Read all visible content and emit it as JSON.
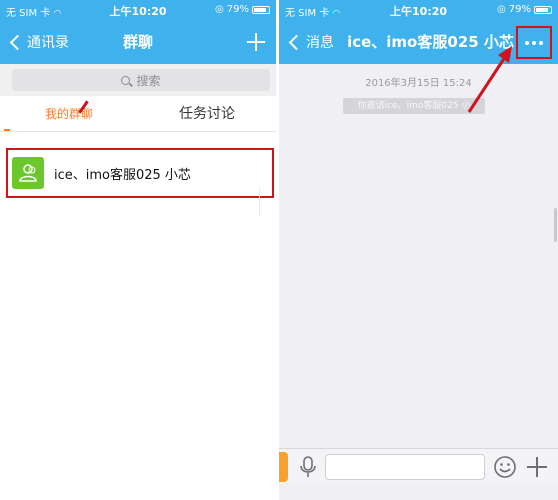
{
  "left": {
    "status": {
      "carrier": "无 SIM 卡",
      "time": "上午10:20",
      "battery": "79%"
    },
    "nav": {
      "back_label": "通讯录",
      "title": "群聊"
    },
    "search": {
      "placeholder": "搜索"
    },
    "tabs": [
      {
        "label": "我的群聊"
      },
      {
        "label": "任务讨论"
      }
    ],
    "groups": [
      {
        "name": "ice、imo客服025 小芯"
      }
    ]
  },
  "right": {
    "status": {
      "carrier": "无 SIM 卡",
      "time": "上午10:20",
      "battery": "79%"
    },
    "nav": {
      "back_label": "消息",
      "title": "ice、imo客服025 小芯"
    },
    "chat": {
      "date": "2016年3月15日 15:24",
      "notice": "你邀请ice、imo客服025 小"
    },
    "input": {
      "value": ""
    }
  },
  "colors": {
    "header_blue": "#3fb1ec",
    "highlight_red": "#d0121b",
    "tab_active_orange": "#ff7b2c",
    "avatar_green": "#6bc72b",
    "side_tab_orange": "#f7a12b"
  },
  "icons": [
    "back-chevron-icon",
    "plus-icon",
    "search-icon",
    "group-avatar-icon",
    "more-dots-icon",
    "microphone-icon",
    "emoji-icon",
    "add-icon",
    "wifi-icon",
    "battery-icon",
    "lock-rotation-icon"
  ]
}
